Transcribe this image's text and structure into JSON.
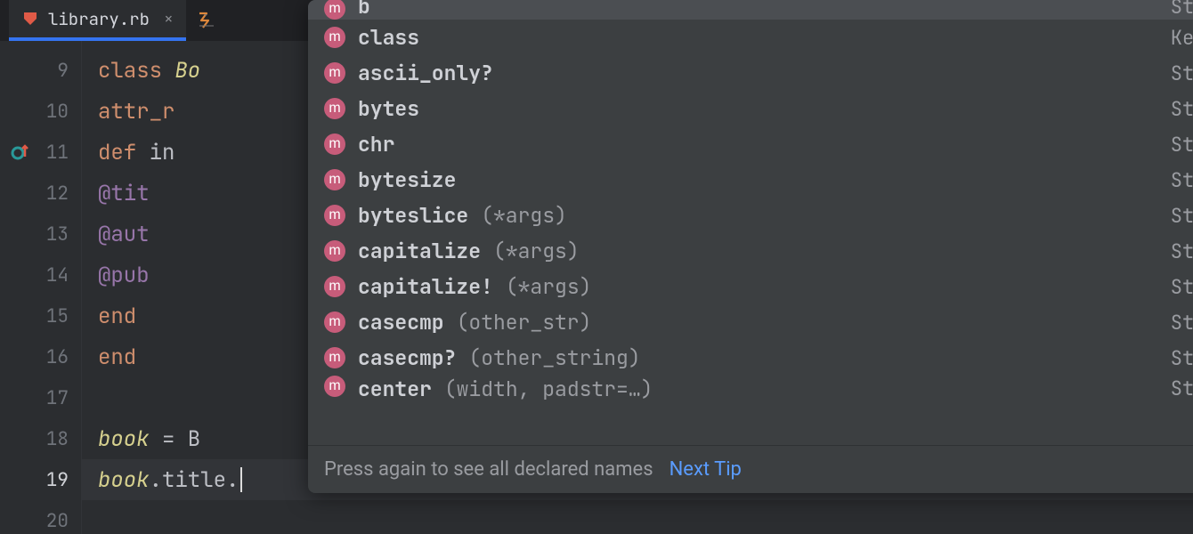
{
  "tab": {
    "filename": "library.rb"
  },
  "gutter": {
    "start": 9,
    "end": 20,
    "active": 19
  },
  "code": {
    "lines": [
      {
        "n": 9,
        "html": "<span class='k'>class </span><span class='cls'>Bo</span>",
        "fold": true
      },
      {
        "n": 10,
        "html": "  <span class='attr'>attr_r</span>"
      },
      {
        "n": 11,
        "html": "  <span class='k'>def </span><span class='t'>in</span>",
        "fold": true,
        "marker": "override-up"
      },
      {
        "n": 12,
        "html": "    <span class='id'>@tit</span>"
      },
      {
        "n": 13,
        "html": "    <span class='id'>@aut</span>"
      },
      {
        "n": 14,
        "html": "    <span class='id'>@pub</span>"
      },
      {
        "n": 15,
        "html": "  <span class='k'>end</span>",
        "fold": true
      },
      {
        "n": 16,
        "html": "<span class='k'>end</span>",
        "fold": true
      },
      {
        "n": 17,
        "html": ""
      },
      {
        "n": 18,
        "html": "<span class='v'>book</span><span class='t'> = B</span>"
      },
      {
        "n": 19,
        "html": "<span class='v'>book</span><span class='t'>.title.</span><span class='caret'></span>",
        "active": true
      },
      {
        "n": 20,
        "html": ""
      }
    ]
  },
  "completion": {
    "items": [
      {
        "name": "b",
        "args": "",
        "origin": "String",
        "selected": true,
        "cut": "top"
      },
      {
        "name": "class",
        "args": "",
        "origin": "Kernel"
      },
      {
        "name": "ascii_only?",
        "args": "",
        "origin": "String"
      },
      {
        "name": "bytes",
        "args": "",
        "origin": "String"
      },
      {
        "name": "chr",
        "args": "",
        "origin": "String"
      },
      {
        "name": "bytesize",
        "args": "",
        "origin": "String"
      },
      {
        "name": "byteslice",
        "args": "(*args)",
        "origin": "String"
      },
      {
        "name": "capitalize",
        "args": "(*args)",
        "origin": "String"
      },
      {
        "name": "capitalize!",
        "args": "(*args)",
        "origin": "String"
      },
      {
        "name": "casecmp",
        "args": "(other_str)",
        "origin": "String"
      },
      {
        "name": "casecmp?",
        "args": "(other_string)",
        "origin": "String"
      },
      {
        "name": "center",
        "args": "(width, padstr=…)",
        "origin": "String",
        "cut": "bottom"
      }
    ],
    "footer_hint": "Press again to see all declared names",
    "footer_link": "Next Tip"
  }
}
